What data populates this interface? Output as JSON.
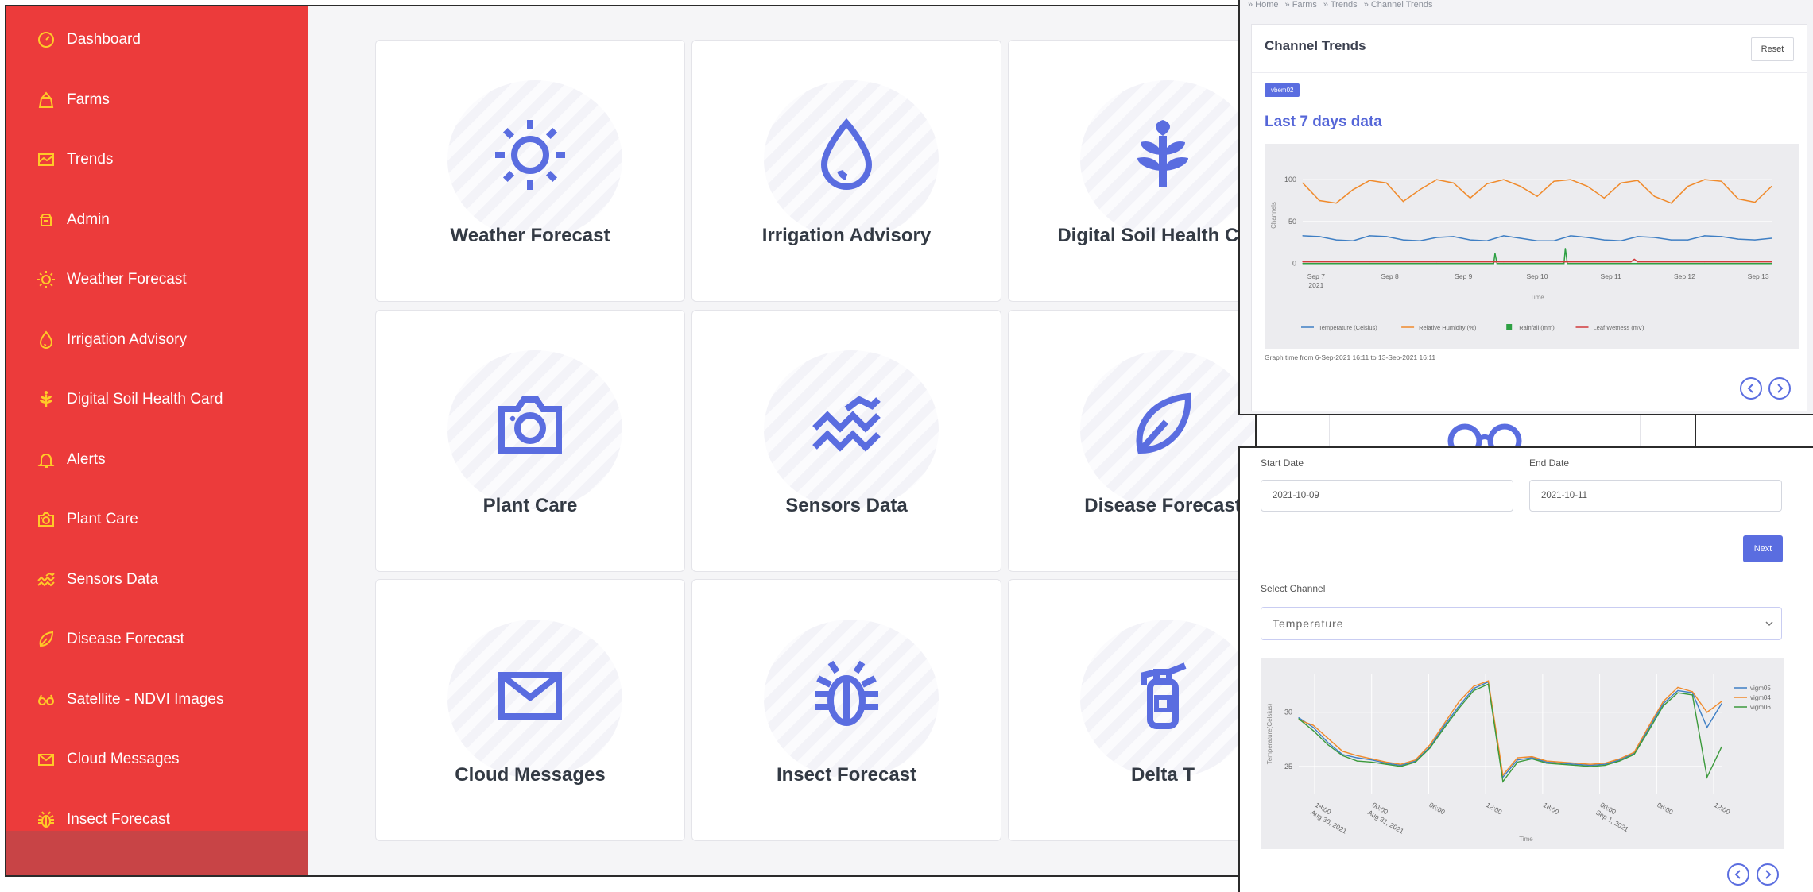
{
  "sidebar": {
    "items": [
      {
        "label": "Dashboard",
        "icon": "dashboard-icon"
      },
      {
        "label": "Farms",
        "icon": "farm-icon"
      },
      {
        "label": "Trends",
        "icon": "trends-icon"
      },
      {
        "label": "Admin",
        "icon": "admin-icon"
      },
      {
        "label": "Weather Forecast",
        "icon": "sun-icon"
      },
      {
        "label": "Irrigation Advisory",
        "icon": "drop-icon"
      },
      {
        "label": "Digital Soil Health Card",
        "icon": "plant-icon"
      },
      {
        "label": "Alerts",
        "icon": "bell-icon"
      },
      {
        "label": "Plant Care",
        "icon": "camera-icon"
      },
      {
        "label": "Sensors Data",
        "icon": "waves-icon"
      },
      {
        "label": "Disease Forecast",
        "icon": "leaf-icon"
      },
      {
        "label": "Satellite - NDVI Images",
        "icon": "glasses-icon"
      },
      {
        "label": "Cloud Messages",
        "icon": "envelope-icon"
      },
      {
        "label": "Insect Forecast",
        "icon": "bug-icon"
      }
    ]
  },
  "cards": [
    {
      "label": "Weather Forecast",
      "icon": "sun-icon"
    },
    {
      "label": "Irrigation Advisory",
      "icon": "drop-icon"
    },
    {
      "label": "Digital Soil Health Card",
      "icon": "plant-icon"
    },
    {
      "label": "Plant Care",
      "icon": "camera-icon"
    },
    {
      "label": "Sensors Data",
      "icon": "waves-icon"
    },
    {
      "label": "Disease Forecast",
      "icon": "leaf-icon"
    },
    {
      "label": "Cloud Messages",
      "icon": "envelope-icon"
    },
    {
      "label": "Insect Forecast",
      "icon": "bug-icon"
    },
    {
      "label": "Delta T",
      "icon": "extinguisher-icon"
    }
  ],
  "trends_panel": {
    "breadcrumb": [
      "Home",
      "Farms",
      "Trends",
      "Channel Trends"
    ],
    "title": "Channel Trends",
    "reset_label": "Reset",
    "badge": "vbem02",
    "heading": "Last 7 days data",
    "graph_time": "Graph time from 6-Sep-2021 16:11 to 13-Sep-2021 16:11"
  },
  "form_panel": {
    "start_date_label": "Start Date",
    "start_date_value": "2021-10-09",
    "end_date_label": "End Date",
    "end_date_value": "2021-10-11",
    "next_label": "Next",
    "select_channel_label": "Select Channel",
    "select_channel_value": "Temperature"
  },
  "colors": {
    "sidebar_bg": "#ec3b3b",
    "sidebar_icon": "#ffc928",
    "accent": "#5a6de0",
    "temperature": "#3f7fc4",
    "humidity": "#f08a2b",
    "rainfall": "#2ea043",
    "leaf_wetness": "#d23a3a"
  },
  "chart_data": [
    {
      "type": "line",
      "title": "Last 7 days data",
      "xlabel": "Time",
      "ylabel": "Channels",
      "x_ticks": [
        "Sep 7\n2021",
        "Sep 8",
        "Sep 9",
        "Sep 10",
        "Sep 11",
        "Sep 12",
        "Sep 13"
      ],
      "y_ticks": [
        0,
        50,
        100
      ],
      "ylim": [
        -5,
        120
      ],
      "legend": "bottom",
      "series": [
        {
          "name": "Temperature (Celsius)",
          "color": "#3f7fc4",
          "x": [
            0,
            0.25,
            0.5,
            0.75,
            1,
            1.25,
            1.5,
            1.75,
            2,
            2.25,
            2.5,
            2.75,
            3,
            3.25,
            3.5,
            3.75,
            4,
            4.25,
            4.5,
            4.75,
            5,
            5.25,
            5.5,
            5.75,
            6,
            6.25,
            6.5,
            6.75,
            7
          ],
          "values": [
            33,
            32,
            28,
            27,
            33,
            32,
            28,
            27,
            31,
            32,
            28,
            27,
            33,
            30,
            27,
            27,
            33,
            31,
            28,
            27,
            32,
            31,
            28,
            28,
            33,
            32,
            29,
            28,
            30
          ]
        },
        {
          "name": "Relative Humidity (%)",
          "color": "#f08a2b",
          "x": [
            0,
            0.25,
            0.5,
            0.75,
            1,
            1.25,
            1.5,
            1.75,
            2,
            2.25,
            2.5,
            2.75,
            3,
            3.25,
            3.5,
            3.75,
            4,
            4.25,
            4.5,
            4.75,
            5,
            5.25,
            5.5,
            5.75,
            6,
            6.25,
            6.5,
            6.75,
            7
          ],
          "values": [
            96,
            75,
            72,
            88,
            99,
            96,
            74,
            88,
            100,
            96,
            78,
            95,
            100,
            92,
            80,
            98,
            100,
            92,
            78,
            96,
            99,
            80,
            72,
            92,
            100,
            98,
            77,
            73,
            92
          ]
        },
        {
          "name": "Rainfall (mm)",
          "color": "#2ea043",
          "x": [
            0,
            1,
            2,
            2.85,
            2.87,
            2.9,
            3,
            3.9,
            3.92,
            3.95,
            4,
            5,
            6,
            7
          ],
          "values": [
            0,
            0,
            0,
            0,
            12,
            0,
            0,
            0,
            18,
            0,
            0,
            0,
            0,
            0
          ]
        },
        {
          "name": "Leaf Wetness (mV)",
          "color": "#d23a3a",
          "x": [
            0,
            1,
            2,
            3,
            4,
            4.9,
            4.95,
            5,
            6,
            7
          ],
          "values": [
            2,
            2,
            2,
            2,
            2,
            2,
            5,
            2,
            2,
            2
          ]
        }
      ]
    },
    {
      "type": "line",
      "xlabel": "Time",
      "ylabel": "Temperature(Celsius)",
      "x_ticks": [
        "18:00\nAug 30, 2021",
        "00:00\nAug 31, 2021",
        "06:00",
        "12:00",
        "18:00",
        "00:00\nSep 1, 2021",
        "06:00",
        "12:00"
      ],
      "y_ticks": [
        25,
        30
      ],
      "ylim": [
        22.5,
        33.5
      ],
      "legend": "top-right",
      "series": [
        {
          "name": "vigm05",
          "color": "#3f7fc4",
          "x": [
            0,
            1,
            2,
            3,
            4,
            5,
            6,
            7,
            8,
            9,
            10,
            11,
            12,
            13,
            14,
            15,
            16,
            17,
            18,
            19,
            20,
            21,
            22,
            23,
            24,
            25,
            26,
            27,
            28,
            29
          ],
          "values": [
            29.5,
            28.6,
            27.2,
            26.1,
            25.8,
            25.6,
            25.3,
            25.1,
            25.5,
            26.8,
            28.8,
            30.6,
            32.2,
            32.8,
            24.0,
            25.6,
            25.8,
            25.4,
            25.3,
            25.2,
            25.1,
            25.2,
            25.6,
            26.2,
            28.5,
            30.8,
            32.0,
            31.8,
            28.6,
            30.8
          ],
          "note": ""
        },
        {
          "name": "vigm04",
          "color": "#f08a2b",
          "x": [
            0,
            1,
            2,
            3,
            4,
            5,
            6,
            7,
            8,
            9,
            10,
            11,
            12,
            13,
            14,
            15,
            16,
            17,
            18,
            19,
            20,
            21,
            22,
            23,
            24,
            25,
            26,
            27,
            28,
            29
          ],
          "values": [
            29.3,
            28.8,
            27.6,
            26.4,
            26.0,
            25.7,
            25.4,
            25.2,
            25.6,
            27.0,
            29.0,
            31.0,
            32.4,
            32.9,
            24.2,
            25.8,
            25.9,
            25.5,
            25.4,
            25.3,
            25.2,
            25.3,
            25.7,
            26.3,
            28.7,
            31.0,
            32.3,
            31.9,
            30.0,
            31.0
          ]
        },
        {
          "name": "vigm06",
          "color": "#3c9a3c",
          "x": [
            0,
            1,
            2,
            3,
            4,
            5,
            6,
            7,
            8,
            9,
            10,
            11,
            12,
            13,
            14,
            15,
            16,
            17,
            18,
            19,
            20,
            21,
            22,
            23,
            24,
            25,
            26,
            27,
            28,
            29
          ],
          "values": [
            29.4,
            28.3,
            27.0,
            26.0,
            25.5,
            25.4,
            25.2,
            25.0,
            25.4,
            26.7,
            28.6,
            30.4,
            32.0,
            32.6,
            23.6,
            25.4,
            25.7,
            25.3,
            25.2,
            25.1,
            25.0,
            25.1,
            25.5,
            26.1,
            28.3,
            30.6,
            31.8,
            31.6,
            24.0,
            26.8
          ]
        }
      ]
    }
  ]
}
